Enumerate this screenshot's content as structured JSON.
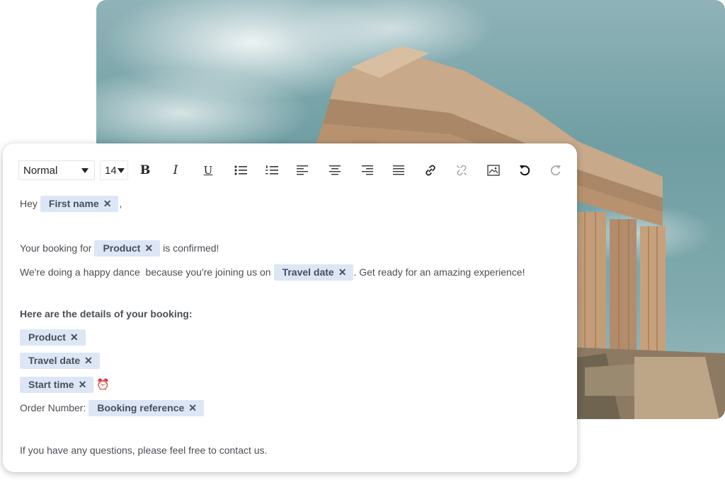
{
  "toolbar": {
    "style_select": "Normal",
    "size_select": "14",
    "buttons": [
      "bold-icon",
      "italic-icon",
      "underline-icon",
      "bullet-list-icon",
      "numbered-list-icon",
      "align-left-icon",
      "align-center-icon",
      "align-right-icon",
      "align-justify-icon",
      "link-icon",
      "unlink-icon",
      "image-icon",
      "undo-icon",
      "redo-icon"
    ],
    "bold_label": "B",
    "italic_label": "I",
    "underline_label": "U"
  },
  "editor": {
    "greeting": "Hey",
    "greeting_chip": "First name",
    "greeting_end": ",",
    "booking_prefix": "Your booking for",
    "booking_chip": "Product",
    "booking_suffix": "is confirmed!",
    "dance_prefix": "We're doing a happy dance  because you're joining us on",
    "dance_chip": "Travel date",
    "dance_suffix": ". Get ready for an amazing experience!",
    "details_heading": "Here are the details of your booking:",
    "detail_chip_1": "Product",
    "detail_chip_2": "Travel date",
    "detail_chip_3": "Start time",
    "alarm_emoji": "⏰",
    "order_label": "Order Number:",
    "order_chip": "Booking reference",
    "closing": "If you have any questions, please feel free to contact us.",
    "chip_remove": "✕"
  },
  "colors": {
    "chip_bg": "#dce6f5",
    "chip_text": "#46505c",
    "body_text": "#4a4f55"
  }
}
